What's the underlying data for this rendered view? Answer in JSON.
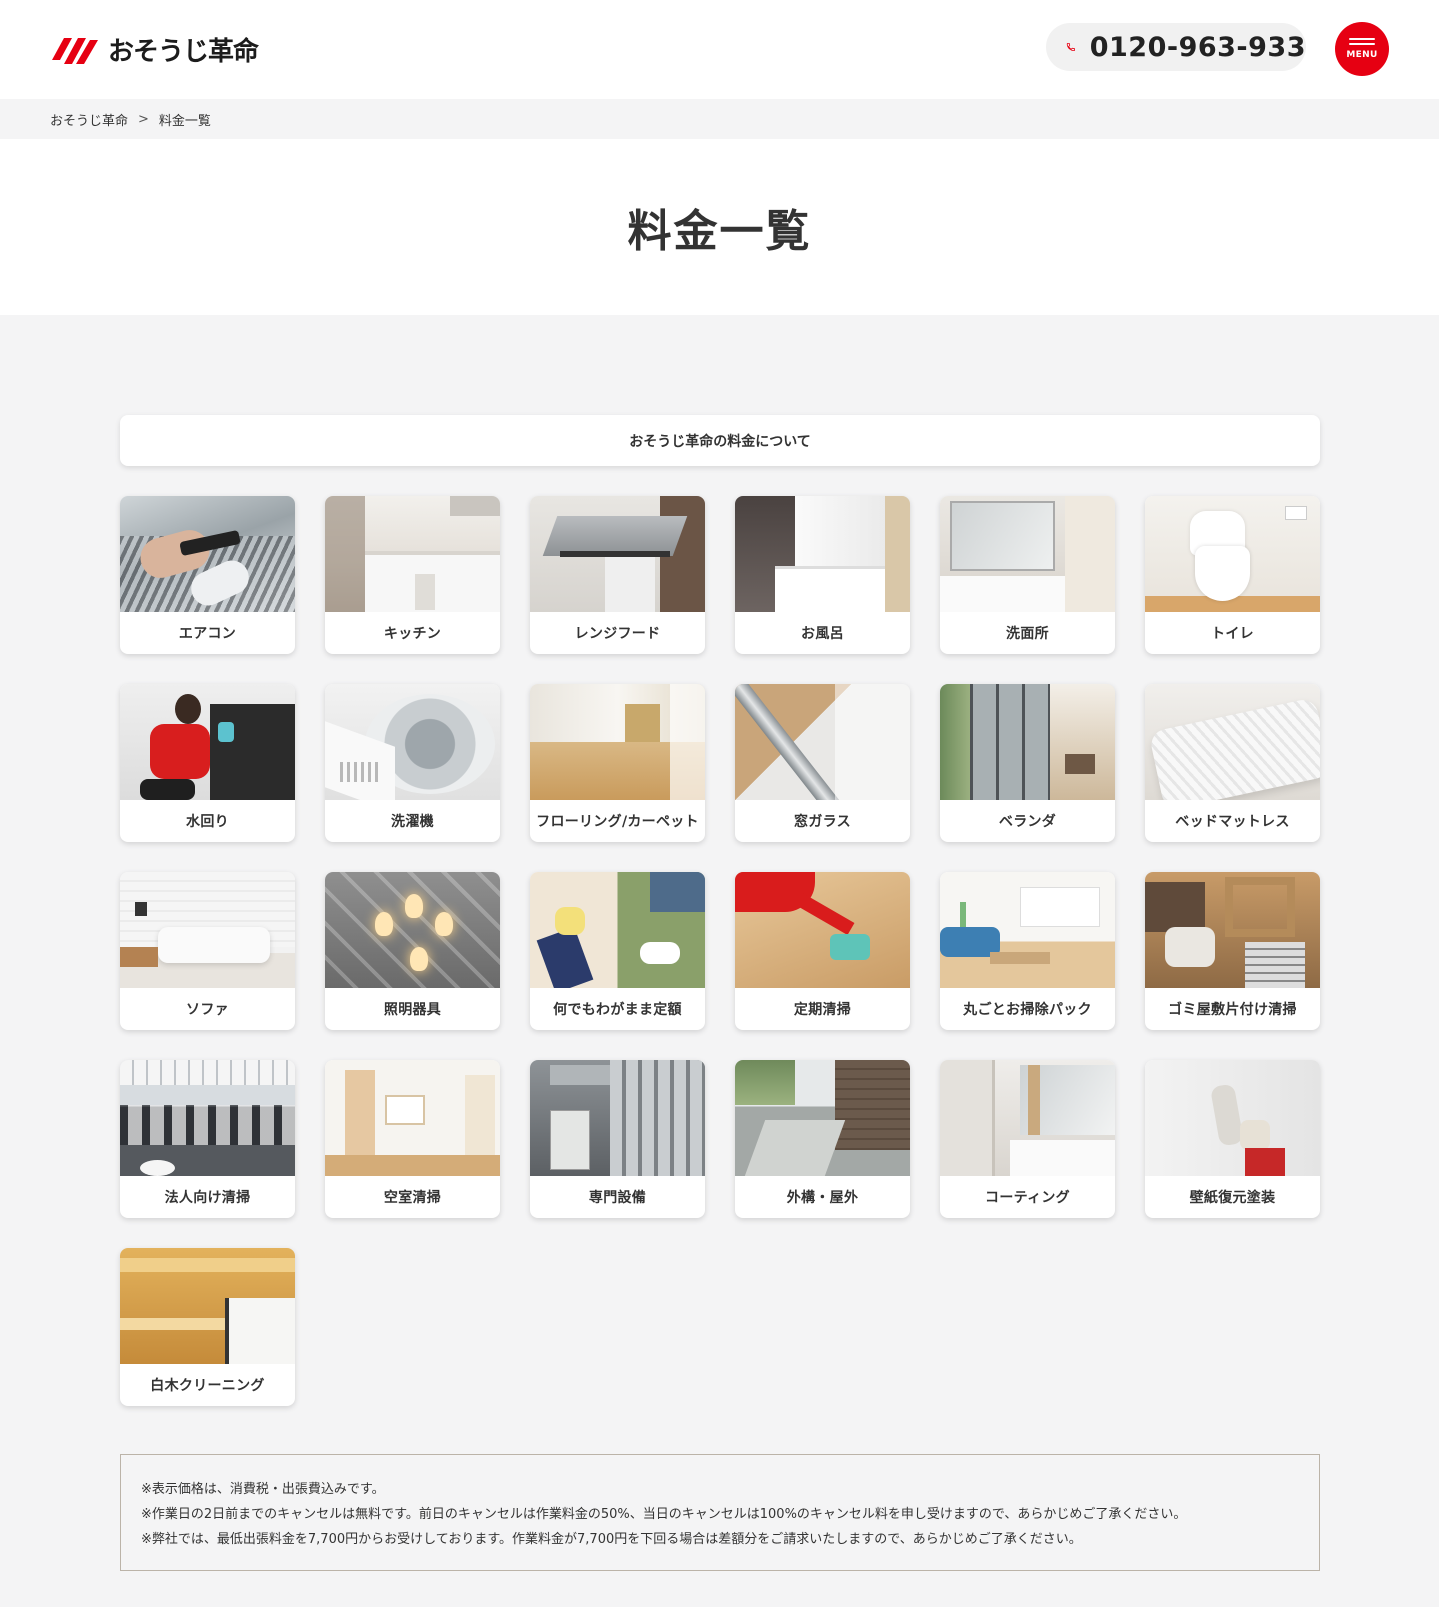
{
  "header": {
    "logo_text": "おそうじ革命",
    "phone": "0120-963-933",
    "menu_label": "MENU"
  },
  "breadcrumb": {
    "home": "おそうじ革命",
    "separator": ">",
    "current": "料金一覧"
  },
  "page_title": "料金一覧",
  "about_link": "おそうじ革命の料金について",
  "services": [
    {
      "label": "エアコン",
      "image": "aircon-cleaning-photo"
    },
    {
      "label": "キッチン",
      "image": "kitchen-photo"
    },
    {
      "label": "レンジフード",
      "image": "range-hood-photo"
    },
    {
      "label": "お風呂",
      "image": "bathroom-photo"
    },
    {
      "label": "洗面所",
      "image": "washroom-photo"
    },
    {
      "label": "トイレ",
      "image": "toilet-photo"
    },
    {
      "label": "水回り",
      "image": "staff-cleaning-photo"
    },
    {
      "label": "洗濯機",
      "image": "washing-machine-photo"
    },
    {
      "label": "フローリング/カーペット",
      "image": "flooring-photo"
    },
    {
      "label": "窓ガラス",
      "image": "window-glass-photo"
    },
    {
      "label": "ベランダ",
      "image": "veranda-photo"
    },
    {
      "label": "ベッドマットレス",
      "image": "mattress-photo"
    },
    {
      "label": "ソファ",
      "image": "sofa-photo"
    },
    {
      "label": "照明器具",
      "image": "chandelier-photo"
    },
    {
      "label": "何でもわがまま定額",
      "image": "gloves-photo"
    },
    {
      "label": "定期清掃",
      "image": "floor-wiping-photo"
    },
    {
      "label": "丸ごとお掃除パック",
      "image": "living-room-photo"
    },
    {
      "label": "ゴミ屋敷片付け清掃",
      "image": "clutter-photo"
    },
    {
      "label": "法人向け清掃",
      "image": "office-photo"
    },
    {
      "label": "空室清掃",
      "image": "empty-room-photo"
    },
    {
      "label": "専門設備",
      "image": "equipment-photo"
    },
    {
      "label": "外構・屋外",
      "image": "exterior-photo"
    },
    {
      "label": "コーティング",
      "image": "vanity-photo"
    },
    {
      "label": "壁紙復元塗装",
      "image": "wall-painting-photo"
    },
    {
      "label": "白木クリーニング",
      "image": "wood-beam-photo"
    }
  ],
  "notes": [
    "※表示価格は、消費税・出張費込みです。",
    "※作業日の2日前までのキャンセルは無料です。前日のキャンセルは作業料金の50%、当日のキャンセルは100%のキャンセル料を申し受けますので、あらかじめご了承ください。",
    "※弊社では、最低出張料金を7,700円からお受けしております。作業料金が7,700円を下回る場合は差額分をご請求いたしますので、あらかじめご了承ください。"
  ],
  "colors": {
    "brand_red": "#e60012",
    "page_bg": "#f4f4f5",
    "text": "#333333"
  }
}
